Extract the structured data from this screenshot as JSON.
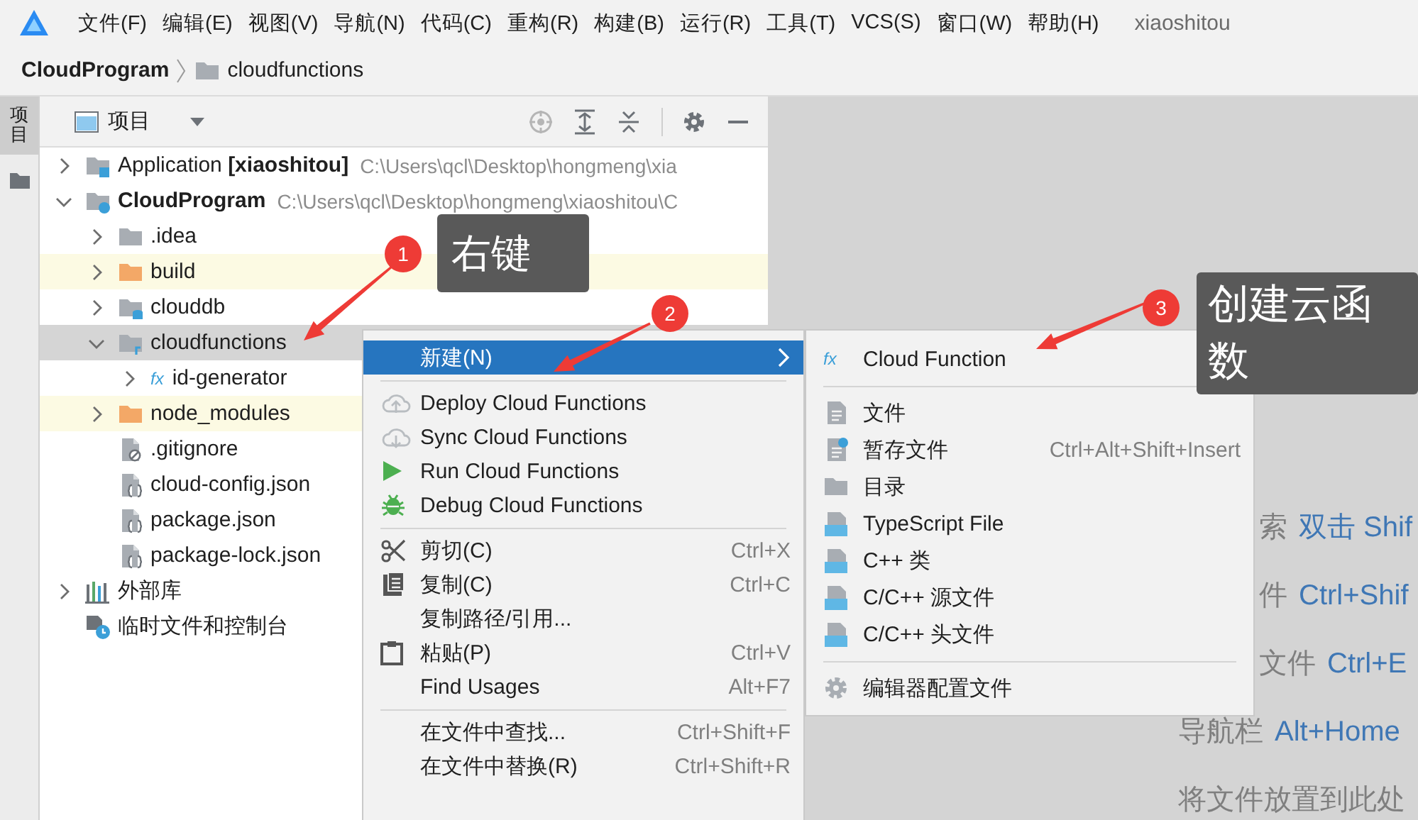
{
  "menu_bar": {
    "items": [
      "文件(F)",
      "编辑(E)",
      "视图(V)",
      "导航(N)",
      "代码(C)",
      "重构(R)",
      "构建(B)",
      "运行(R)",
      "工具(T)",
      "VCS(S)",
      "窗口(W)",
      "帮助(H)"
    ],
    "project_name": "xiaoshitou"
  },
  "breadcrumb": {
    "items": [
      {
        "label": "CloudProgram",
        "kind": "project"
      },
      {
        "label": "cloudfunctions",
        "kind": "folder"
      }
    ]
  },
  "side_strip": {
    "tabs": [
      {
        "label": "项目",
        "selected": true
      }
    ]
  },
  "project_panel": {
    "title": "项目",
    "tree": [
      {
        "name": "Application **[xiaoshitou]**",
        "path": "C:\\Users\\qcl\\Desktop\\hongmeng\\xia",
        "kind": "module",
        "expanded": false,
        "selected": false,
        "excluded": false
      },
      {
        "name": "CloudProgram",
        "bold": true,
        "path": "C:\\Users\\qcl\\Desktop\\hongmeng\\xiaoshitou\\C",
        "kind": "cloud_module",
        "expanded": true,
        "selected": false,
        "excluded": false,
        "children": [
          {
            "name": ".idea",
            "kind": "folder",
            "expanded": false,
            "selected": false,
            "excluded": false
          },
          {
            "name": "build",
            "kind": "folder",
            "expanded": false,
            "selected": false,
            "excluded": true
          },
          {
            "name": "clouddb",
            "kind": "db_folder",
            "expanded": false,
            "selected": false,
            "excluded": false
          },
          {
            "name": "cloudfunctions",
            "kind": "functions_folder",
            "expanded": true,
            "selected": true,
            "excluded": false,
            "children": [
              {
                "name": "id-generator",
                "kind": "function",
                "icon_text": "fx",
                "expanded": false,
                "selected": false
              }
            ]
          },
          {
            "name": "node_modules",
            "kind": "folder",
            "expanded": false,
            "selected": false,
            "excluded": true
          },
          {
            "name": ".gitignore",
            "kind": "ignore_file",
            "selected": false
          },
          {
            "name": "cloud-config.json",
            "kind": "json_file",
            "selected": false
          },
          {
            "name": "package.json",
            "kind": "json_file",
            "selected": false
          },
          {
            "name": "package-lock.json",
            "kind": "json_file",
            "selected": false
          }
        ]
      },
      {
        "name": "外部库",
        "kind": "library",
        "expanded": false,
        "selected": false
      },
      {
        "name": "临时文件和控制台",
        "kind": "scratch",
        "selected": false
      }
    ]
  },
  "context_menu": {
    "items": [
      {
        "kind": "submenu",
        "label": "新建(N)",
        "selected": true
      },
      {
        "kind": "separator"
      },
      {
        "kind": "item",
        "label": "Deploy Cloud Functions",
        "selected": false
      },
      {
        "kind": "item",
        "label": "Sync Cloud Functions",
        "selected": false
      },
      {
        "kind": "item",
        "label": "Run Cloud Functions",
        "selected": false
      },
      {
        "kind": "item",
        "label": "Debug Cloud Functions",
        "selected": false
      },
      {
        "kind": "separator"
      },
      {
        "kind": "item",
        "label": "剪切(C)",
        "shortcut": "Ctrl+X",
        "selected": false
      },
      {
        "kind": "item",
        "label": "复制(C)",
        "shortcut": "Ctrl+C",
        "selected": false
      },
      {
        "kind": "item",
        "label": "复制路径/引用...",
        "selected": false
      },
      {
        "kind": "item",
        "label": "粘贴(P)",
        "shortcut": "Ctrl+V",
        "selected": false
      },
      {
        "kind": "item",
        "label": "Find Usages",
        "shortcut": "Alt+F7",
        "selected": false
      },
      {
        "kind": "separator"
      },
      {
        "kind": "item",
        "label": "在文件中查找...",
        "shortcut": "Ctrl+Shift+F",
        "selected": false
      },
      {
        "kind": "item",
        "label": "在文件中替换(R)",
        "shortcut": "Ctrl+Shift+R",
        "selected": false
      }
    ]
  },
  "submenu": {
    "items": [
      {
        "kind": "item",
        "label": "Cloud Function",
        "icon_text": "fx",
        "selected": false
      },
      {
        "kind": "separator"
      },
      {
        "kind": "item",
        "label": "文件",
        "selected": false
      },
      {
        "kind": "item",
        "label": "暂存文件",
        "shortcut": "Ctrl+Alt+Shift+Insert",
        "selected": false
      },
      {
        "kind": "item",
        "label": "目录",
        "selected": false
      },
      {
        "kind": "item",
        "label": "TypeScript File",
        "selected": false
      },
      {
        "kind": "item",
        "label": "C++ 类",
        "selected": false
      },
      {
        "kind": "item",
        "label": "C/C++ 源文件",
        "selected": false
      },
      {
        "kind": "item",
        "label": "C/C++ 头文件",
        "selected": false
      },
      {
        "kind": "separator"
      },
      {
        "kind": "item",
        "label": "编辑器配置文件",
        "selected": false
      }
    ]
  },
  "editor_hints": [
    {
      "label": "索",
      "shortcut": "双击 Shif"
    },
    {
      "label": "件",
      "shortcut": "Ctrl+Shif"
    },
    {
      "label": "文件",
      "shortcut": "Ctrl+E"
    },
    {
      "label": "导航栏",
      "shortcut": "Alt+Home"
    },
    {
      "label": "将文件放置到此处"
    }
  ],
  "annotations": [
    {
      "number": "1",
      "tooltip": "右键"
    },
    {
      "number": "2"
    },
    {
      "number": "3",
      "tooltip": "创建云函数"
    }
  ]
}
